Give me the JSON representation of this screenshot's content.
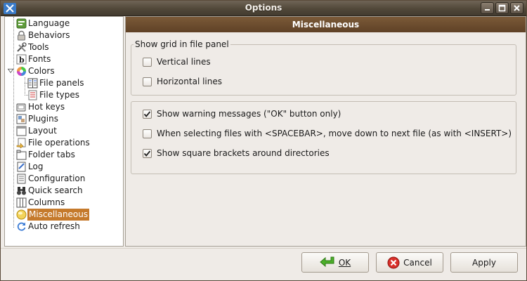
{
  "window": {
    "title": "Options",
    "controls": [
      "minimize-icon",
      "maximize-icon",
      "close-icon"
    ]
  },
  "tree": {
    "items": [
      {
        "label": "Language",
        "icon": "language-icon"
      },
      {
        "label": "Behaviors",
        "icon": "lock-icon"
      },
      {
        "label": "Tools",
        "icon": "tools-icon"
      },
      {
        "label": "Fonts",
        "icon": "font-icon"
      },
      {
        "label": "Colors",
        "icon": "color-wheel-icon"
      },
      {
        "label": "File panels",
        "icon": "file-panels-icon"
      },
      {
        "label": "File types",
        "icon": "file-types-icon"
      },
      {
        "label": "Hot keys",
        "icon": "hotkeys-icon"
      },
      {
        "label": "Plugins",
        "icon": "plugins-icon"
      },
      {
        "label": "Layout",
        "icon": "layout-icon"
      },
      {
        "label": "File operations",
        "icon": "file-operations-icon"
      },
      {
        "label": "Folder tabs",
        "icon": "folder-tabs-icon"
      },
      {
        "label": "Log",
        "icon": "log-icon"
      },
      {
        "label": "Configuration",
        "icon": "configuration-icon"
      },
      {
        "label": "Quick search",
        "icon": "binoculars-icon"
      },
      {
        "label": "Columns",
        "icon": "columns-icon"
      },
      {
        "label": "Miscellaneous",
        "icon": "miscellaneous-icon",
        "selected": true
      },
      {
        "label": "Auto refresh",
        "icon": "refresh-icon"
      }
    ]
  },
  "panel": {
    "header": "Miscellaneous",
    "grid_group": {
      "title": "Show grid in file panel",
      "vertical_lines": {
        "label": "Vertical lines",
        "checked": false
      },
      "horizontal_lines": {
        "label": "Horizontal lines",
        "checked": false
      }
    },
    "options": {
      "show_warning": {
        "label": "Show warning messages (\"OK\" button only)",
        "checked": true
      },
      "spacebar_move": {
        "label": "When selecting files with <SPACEBAR>, move down to next file (as with <INSERT>)",
        "checked": false
      },
      "square_brackets": {
        "label": "Show square brackets around directories",
        "checked": true
      }
    }
  },
  "buttons": {
    "ok": {
      "label": "OK",
      "icon": "checkmark-arrow-icon"
    },
    "cancel": {
      "label": "Cancel",
      "icon": "cancel-icon"
    },
    "apply": {
      "label": "Apply"
    }
  },
  "colors": {
    "selection": "#c57a2c",
    "header_bg": "#6d4d2f",
    "titlebar_bg": "#514839"
  }
}
